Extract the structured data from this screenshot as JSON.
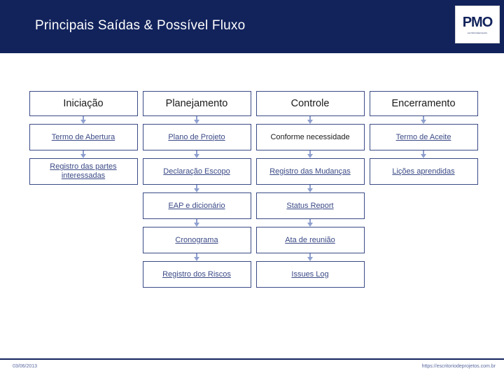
{
  "header": {
    "title": "Principais Saídas & Possível Fluxo",
    "logo": {
      "mark": "PMO",
      "sub": "escritoriodeprojetos"
    }
  },
  "diagram": {
    "columns": [
      {
        "header": "Iniciação",
        "items": [
          {
            "label": "Termo de Abertura",
            "underlined": true
          },
          {
            "label": "Registro das partes interessadas",
            "underlined": true
          }
        ]
      },
      {
        "header": "Planejamento",
        "items": [
          {
            "label": "Plano de Projeto",
            "underlined": true
          },
          {
            "label": "Declaração Escopo",
            "underlined": true
          },
          {
            "label": "EAP e dicionário",
            "underlined": true
          },
          {
            "label": "Cronograma",
            "underlined": true
          },
          {
            "label": "Registro dos Riscos",
            "underlined": true
          }
        ]
      },
      {
        "header": "Controle",
        "items": [
          {
            "label": "Conforme necessidade",
            "underlined": false
          },
          {
            "label": "Registro das Mudanças",
            "underlined": true
          },
          {
            "label": "Status Report",
            "underlined": true
          },
          {
            "label": "Ata de reunião",
            "underlined": true
          },
          {
            "label": "Issues Log",
            "underlined": true
          }
        ]
      },
      {
        "header": "Encerramento",
        "items": [
          {
            "label": "Termo de Aceite",
            "underlined": true
          },
          {
            "label": "Lições aprendidas",
            "underlined": true
          }
        ]
      }
    ]
  },
  "footer": {
    "date": "03/06/2013",
    "url": "https://escritoriodeprojetos.com.br"
  },
  "colors": {
    "header_bg": "#12235c",
    "node_border": "#3b4a86",
    "link_text": "#3b4a86",
    "arrow": "#8fa0cf"
  }
}
